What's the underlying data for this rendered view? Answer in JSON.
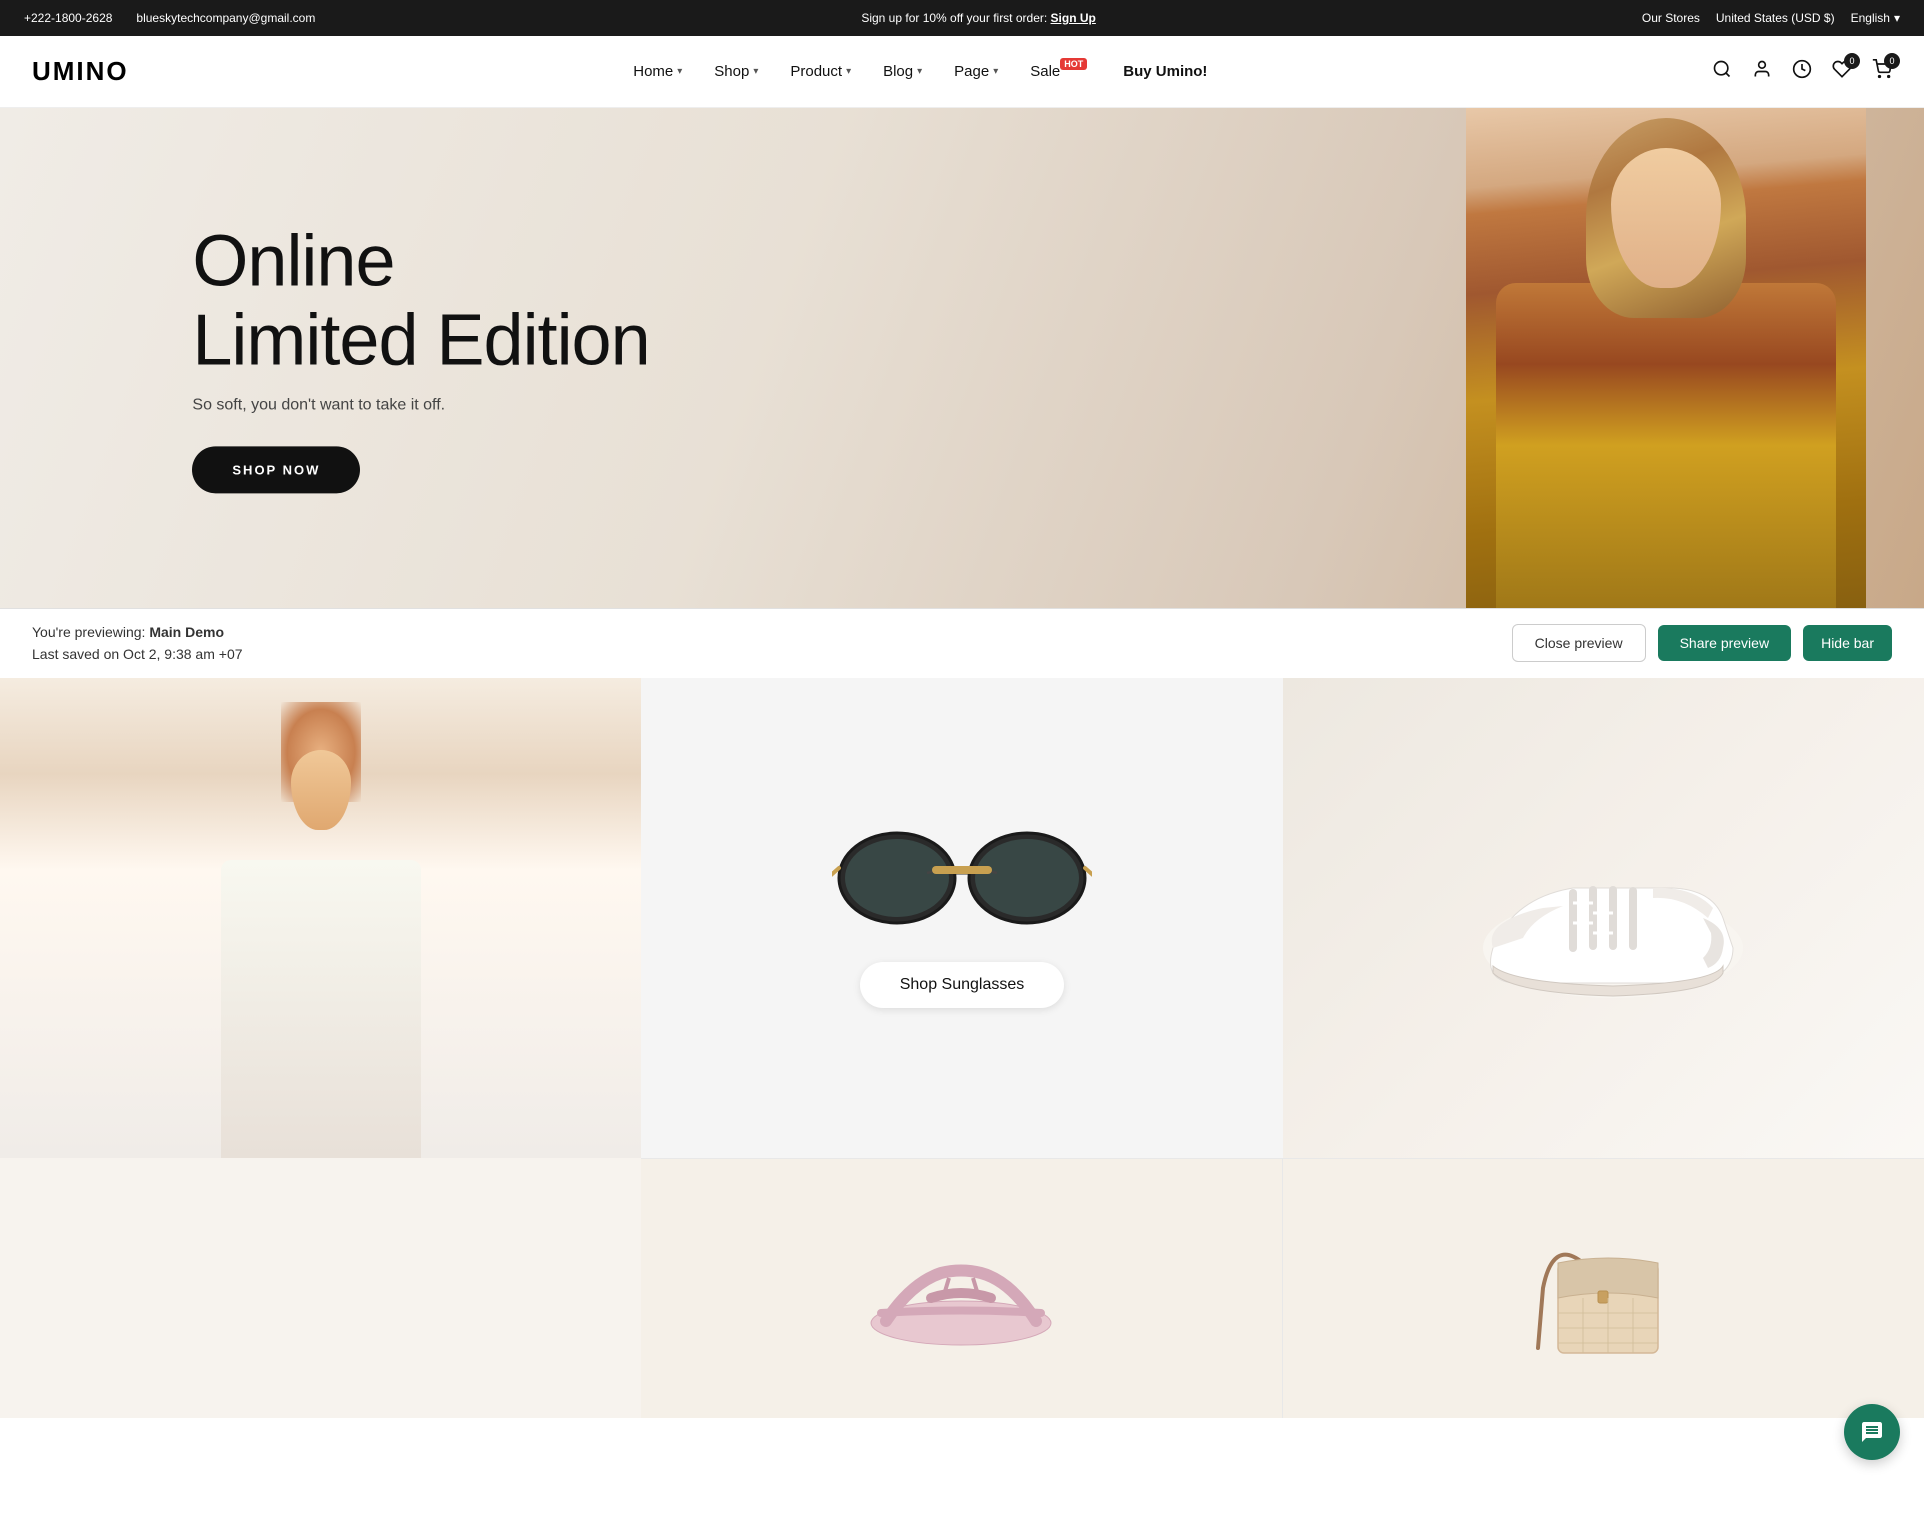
{
  "topbar": {
    "phone": "+222-1800-2628",
    "email": "blueskytechcompany@gmail.com",
    "promo_text": "Sign up for 10% off your first order:",
    "promo_link": "Sign Up",
    "stores": "Our Stores",
    "currency": "United States (USD $)",
    "language": "English"
  },
  "nav": {
    "logo": "UMINO",
    "links": [
      {
        "label": "Home",
        "has_dropdown": true
      },
      {
        "label": "Shop",
        "has_dropdown": true
      },
      {
        "label": "Product",
        "has_dropdown": true
      },
      {
        "label": "Blog",
        "has_dropdown": true
      },
      {
        "label": "Page",
        "has_dropdown": true
      },
      {
        "label": "Sale",
        "has_dropdown": false,
        "has_hot": true
      },
      {
        "label": "Buy Umino!",
        "has_dropdown": false
      }
    ],
    "wishlist_count": "0",
    "cart_count": "0"
  },
  "hero": {
    "title_line1": "Online",
    "title_line2": "Limited Edition",
    "subtitle": "So soft, you don't want to take it off.",
    "cta": "SHOP NOW"
  },
  "preview_bar": {
    "preview_label": "You're previewing:",
    "theme_name": "Main Demo",
    "saved_text": "Last saved on Oct 2, 9:38 am +07",
    "close_btn": "Close preview",
    "share_btn": "Share preview",
    "hide_btn": "Hide bar"
  },
  "products": {
    "sunglasses_btn": "Shop Sunglasses",
    "sunglasses_alt": "Black sunglasses product"
  },
  "chat": {
    "icon": "💬"
  }
}
